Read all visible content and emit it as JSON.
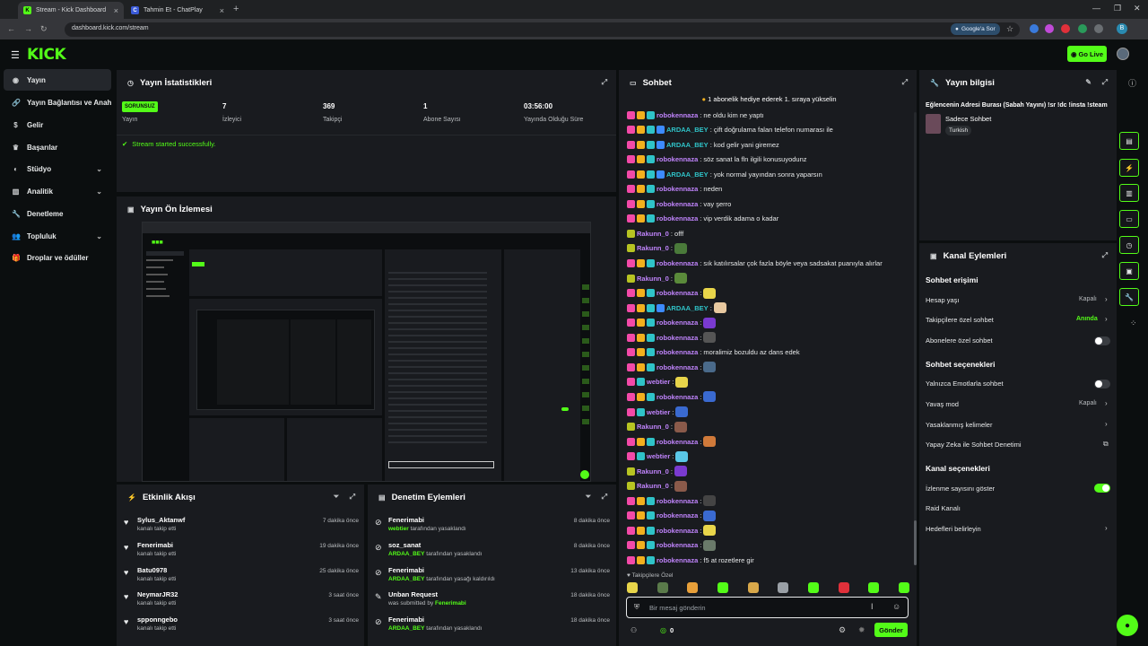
{
  "browser": {
    "tabs": [
      {
        "label": "Stream - Kick Dashboard",
        "fav": "K"
      },
      {
        "label": "Tahmin Et - ChatPlay",
        "fav": "C"
      }
    ],
    "url": "dashboard.kick.com/stream",
    "google_ask": "Google'a Sor"
  },
  "topnav": {
    "logo": "KICK",
    "go_live": "Go Live"
  },
  "sidebar": {
    "items": [
      {
        "label": "Yayın",
        "icon": "broadcast-icon"
      },
      {
        "label": "Yayın Bağlantısı ve Anahtarı",
        "icon": "link-icon"
      },
      {
        "label": "Gelir",
        "icon": "dollar-icon"
      },
      {
        "label": "Başarılar",
        "icon": "trophy-icon"
      },
      {
        "label": "Stüdyo",
        "icon": "palette-icon"
      },
      {
        "label": "Analitik",
        "icon": "chart-icon"
      },
      {
        "label": "Denetleme",
        "icon": "wrench-icon"
      },
      {
        "label": "Topluluk",
        "icon": "people-icon"
      },
      {
        "label": "Droplar ve ödüller",
        "icon": "gift-icon"
      }
    ]
  },
  "stats": {
    "title": "Yayın İstatistikleri",
    "badge": "SORUNSUZ",
    "cells": [
      {
        "value": "",
        "label": "Yayın"
      },
      {
        "value": "7",
        "label": "İzleyici"
      },
      {
        "value": "369",
        "label": "Takipçi"
      },
      {
        "value": "1",
        "label": "Abone Sayısı"
      },
      {
        "value": "03:56:00",
        "label": "Yayında Olduğu Süre"
      }
    ],
    "success": "Stream started successfully."
  },
  "preview": {
    "title": "Yayın Ön İzlemesi"
  },
  "activity": {
    "title": "Etkinlik Akışı",
    "rows": [
      {
        "name": "Sylus_Aktanwf",
        "sub": "kanalı takip etti",
        "time": "7 dakika önce"
      },
      {
        "name": "Fenerimabi",
        "sub": "kanalı takip etti",
        "time": "19 dakika önce"
      },
      {
        "name": "Batu0978",
        "sub": "kanalı takip etti",
        "time": "25 dakika önce"
      },
      {
        "name": "NeymarJR32",
        "sub": "kanalı takip etti",
        "time": "3 saat önce"
      },
      {
        "name": "spponngebo",
        "sub": "kanalı takip etti",
        "time": "3 saat önce"
      }
    ]
  },
  "moderation": {
    "title": "Denetim Eylemleri",
    "rows": [
      {
        "name": "Fenerimabi",
        "actor": "webtier",
        "rest": "tarafından yasaklandı",
        "time": "8 dakika önce"
      },
      {
        "name": "soz_sanat",
        "actor": "ARDAA_BEY",
        "rest": "tarafından yasaklandı",
        "time": "8 dakika önce"
      },
      {
        "name": "Fenerimabi",
        "actor": "ARDAA_BEY",
        "rest": "tarafından yasağı kaldırıldı",
        "time": "13 dakika önce"
      },
      {
        "name": "Unban Request",
        "actor": "Fenerimabi",
        "rest": "was submitted by",
        "time": "18 dakika önce"
      },
      {
        "name": "Fenerimabi",
        "actor": "ARDAA_BEY",
        "rest": "tarafından yasaklandı",
        "time": "18 dakika önce"
      }
    ]
  },
  "chat": {
    "title": "Sohbet",
    "pinned": "1 abonelik hediye ederek 1. sıraya yükselin",
    "messages": [
      {
        "user": "robokennaza",
        "color": "#c084fc",
        "text": ": ne oldu kim ne yaptı",
        "badges": [
          "mod",
          "vip",
          "sub"
        ]
      },
      {
        "user": "ARDAA_BEY",
        "color": "#2fc3c8",
        "text": ": çift doğrulama falan telefon numarası ile",
        "badges": [
          "mod",
          "vip",
          "sub",
          "ver"
        ]
      },
      {
        "user": "ARDAA_BEY",
        "color": "#2fc3c8",
        "text": ": kod gelir yani giremez",
        "badges": [
          "mod",
          "vip",
          "sub",
          "ver"
        ]
      },
      {
        "user": "robokennaza",
        "color": "#c084fc",
        "text": ": söz sanat la fln ilgili konusuyodunz",
        "badges": [
          "mod",
          "vip",
          "sub"
        ]
      },
      {
        "user": "ARDAA_BEY",
        "color": "#2fc3c8",
        "text": ": yok normal yayından sonra yaparsın",
        "badges": [
          "mod",
          "vip",
          "sub",
          "ver"
        ]
      },
      {
        "user": "robokennaza",
        "color": "#c084fc",
        "text": ": neden",
        "badges": [
          "mod",
          "vip",
          "sub"
        ]
      },
      {
        "user": "robokennaza",
        "color": "#c084fc",
        "text": ": vay şerro",
        "badges": [
          "mod",
          "vip",
          "sub"
        ]
      },
      {
        "user": "robokennaza",
        "color": "#c084fc",
        "text": ": vip verdik adama o kadar",
        "badges": [
          "mod",
          "vip",
          "sub"
        ]
      },
      {
        "user": "Rakunn_0",
        "color": "#c084fc",
        "text": ": offf",
        "badges": [
          "fol"
        ]
      },
      {
        "user": "Rakunn_0",
        "color": "#c084fc",
        "text": ":",
        "badges": [
          "fol"
        ],
        "emote": "#4a7a3a"
      },
      {
        "user": "robokennaza",
        "color": "#c084fc",
        "text": ": sık katılırsalar çok fazla böyle veya sadsakat puanıyla alırlar",
        "badges": [
          "mod",
          "vip",
          "sub"
        ]
      },
      {
        "user": "Rakunn_0",
        "color": "#c084fc",
        "text": ":",
        "badges": [
          "fol"
        ],
        "emote": "#5a8a3a"
      },
      {
        "user": "robokennaza",
        "color": "#c084fc",
        "text": ":",
        "badges": [
          "mod",
          "vip",
          "sub"
        ],
        "emote": "#e8d54a"
      },
      {
        "user": "ARDAA_BEY",
        "color": "#2fc3c8",
        "text": ":",
        "badges": [
          "mod",
          "vip",
          "sub",
          "ver"
        ],
        "emote": "#e8c9a0"
      },
      {
        "user": "robokennaza",
        "color": "#c084fc",
        "text": ":",
        "badges": [
          "mod",
          "vip",
          "sub"
        ],
        "emote": "#7a3ad0"
      },
      {
        "user": "robokennaza",
        "color": "#c084fc",
        "text": ":",
        "badges": [
          "mod",
          "vip",
          "sub"
        ],
        "emote": "#555555"
      },
      {
        "user": "robokennaza",
        "color": "#c084fc",
        "text": ": moralimiz bozuldu az dans edek",
        "badges": [
          "mod",
          "vip",
          "sub"
        ]
      },
      {
        "user": "robokennaza",
        "color": "#c084fc",
        "text": ":",
        "badges": [
          "mod",
          "vip",
          "sub"
        ],
        "emote": "#4a6a8a"
      },
      {
        "user": "webtier",
        "color": "#c084fc",
        "text": ":",
        "badges": [
          "mod",
          "sub"
        ],
        "emote": "#e8d54a"
      },
      {
        "user": "robokennaza",
        "color": "#c084fc",
        "text": ":",
        "badges": [
          "mod",
          "vip",
          "sub"
        ],
        "emote": "#3a6ad0"
      },
      {
        "user": "webtier",
        "color": "#c084fc",
        "text": ":",
        "badges": [
          "mod",
          "sub"
        ],
        "emote": "#3a6ad0"
      },
      {
        "user": "Rakunn_0",
        "color": "#c084fc",
        "text": ":",
        "badges": [
          "fol"
        ],
        "emote": "#8a5a4a"
      },
      {
        "user": "robokennaza",
        "color": "#c084fc",
        "text": ":",
        "badges": [
          "mod",
          "vip",
          "sub"
        ],
        "emote": "#d07a3a"
      },
      {
        "user": "webtier",
        "color": "#c084fc",
        "text": ":",
        "badges": [
          "mod",
          "sub"
        ],
        "emote": "#5ac8e8"
      },
      {
        "user": "Rakunn_0",
        "color": "#c084fc",
        "text": ":",
        "badges": [
          "fol"
        ],
        "emote": "#7a3ad0"
      },
      {
        "user": "Rakunn_0",
        "color": "#c084fc",
        "text": ":",
        "badges": [
          "fol"
        ],
        "emote": "#8a5a4a"
      },
      {
        "user": "robokennaza",
        "color": "#c084fc",
        "text": ":",
        "badges": [
          "mod",
          "vip",
          "sub"
        ],
        "emote": "#444444"
      },
      {
        "user": "robokennaza",
        "color": "#c084fc",
        "text": ":",
        "badges": [
          "mod",
          "vip",
          "sub"
        ],
        "emote": "#3a6ad0"
      },
      {
        "user": "robokennaza",
        "color": "#c084fc",
        "text": ":",
        "badges": [
          "mod",
          "vip",
          "sub"
        ],
        "emote": "#e8d54a"
      },
      {
        "user": "robokennaza",
        "color": "#c084fc",
        "text": ":",
        "badges": [
          "mod",
          "vip",
          "sub"
        ],
        "emote": "#6a7a6a"
      },
      {
        "user": "robokennaza",
        "color": "#c084fc",
        "text": ": f5 at rozetlere gir",
        "badges": [
          "mod",
          "vip",
          "sub"
        ]
      }
    ],
    "followers_only": "Takipçilere Özel",
    "input_placeholder": "Bir mesaj gönderin",
    "points": "0",
    "send": "Gönder"
  },
  "info": {
    "title": "Yayın bilgisi",
    "stream_title": "Eğlencenin Adresi Burası (Sabah Yayını) !sr !dc !insta !steam",
    "category": "Sadece Sohbet",
    "tag": "Turkish"
  },
  "actions": {
    "title": "Kanal Eylemleri",
    "chat_access": "Sohbet erişimi",
    "emote_only_section": "Sohbet seçenekleri",
    "channel_section": "Kanal seçenekleri",
    "rows": {
      "account_age": {
        "label": "Hesap yaşı",
        "value": "Kapalı"
      },
      "followers_chat": {
        "label": "Takipçilere özel sohbet",
        "value": "Anında"
      },
      "subs_chat": {
        "label": "Abonelere özel sohbet"
      },
      "emotes_only": {
        "label": "Yalnızca Emotlarla sohbet"
      },
      "slow_mode": {
        "label": "Yavaş mod",
        "value": "Kapalı"
      },
      "banned_words": {
        "label": "Yasaklanmış kelimeler"
      },
      "ai_moderation": {
        "label": "Yapay Zeka ile Sohbet Denetimi"
      },
      "show_viewers": {
        "label": "İzlenme sayısını göster"
      },
      "raid": {
        "label": "Raid Kanalı"
      },
      "targets": {
        "label": "Hedefleri belirleyin"
      }
    }
  },
  "colors": {
    "accent": "#53fc18",
    "panel": "#191b1f",
    "bg": "#0b0e0f"
  }
}
